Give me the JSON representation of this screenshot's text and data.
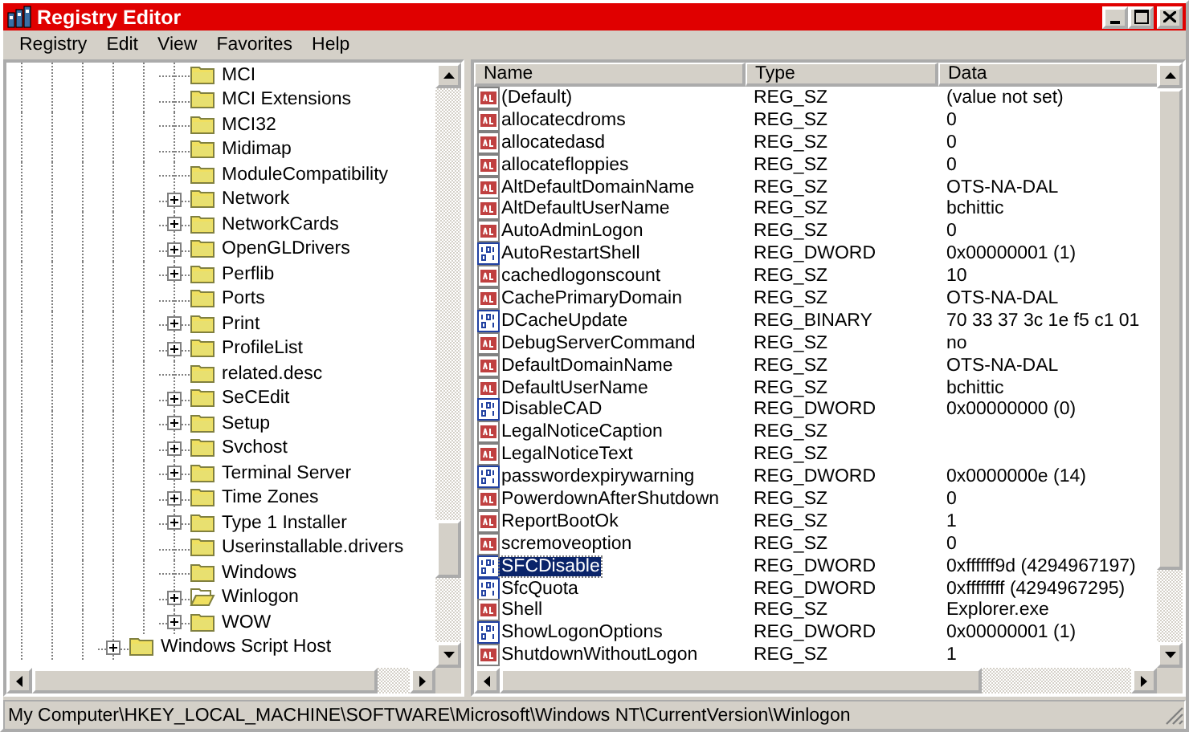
{
  "window": {
    "title": "Registry Editor"
  },
  "menu": [
    "Registry",
    "Edit",
    "View",
    "Favorites",
    "Help"
  ],
  "tree": {
    "nodes": [
      {
        "children": [
          {
            "children": [
              {
                "children": [
                  {
                    "children": [
                      {
                        "children": [
                          {
                            "label": "MCI",
                            "expandable": false,
                            "selected": false
                          },
                          {
                            "label": "MCI Extensions",
                            "expandable": false,
                            "selected": false
                          },
                          {
                            "label": "MCI32",
                            "expandable": false,
                            "selected": false
                          },
                          {
                            "label": "Midimap",
                            "expandable": false,
                            "selected": false
                          },
                          {
                            "label": "ModuleCompatibility",
                            "expandable": false,
                            "selected": false
                          },
                          {
                            "label": "Network",
                            "expandable": true,
                            "selected": false
                          },
                          {
                            "label": "NetworkCards",
                            "expandable": true,
                            "selected": false
                          },
                          {
                            "label": "OpenGLDrivers",
                            "expandable": true,
                            "selected": false
                          },
                          {
                            "label": "Perflib",
                            "expandable": true,
                            "selected": false
                          },
                          {
                            "label": "Ports",
                            "expandable": false,
                            "selected": false
                          },
                          {
                            "label": "Print",
                            "expandable": true,
                            "selected": false
                          },
                          {
                            "label": "ProfileList",
                            "expandable": true,
                            "selected": false
                          },
                          {
                            "label": "related.desc",
                            "expandable": false,
                            "selected": false
                          },
                          {
                            "label": "SeCEdit",
                            "expandable": true,
                            "selected": false
                          },
                          {
                            "label": "Setup",
                            "expandable": true,
                            "selected": false
                          },
                          {
                            "label": "Svchost",
                            "expandable": true,
                            "selected": false
                          },
                          {
                            "label": "Terminal Server",
                            "expandable": true,
                            "selected": false
                          },
                          {
                            "label": "Time Zones",
                            "expandable": true,
                            "selected": false
                          },
                          {
                            "label": "Type 1 Installer",
                            "expandable": true,
                            "selected": false
                          },
                          {
                            "label": "Userinstallable.drivers",
                            "expandable": false,
                            "selected": false
                          },
                          {
                            "label": "Windows",
                            "expandable": false,
                            "selected": false
                          },
                          {
                            "label": "Winlogon",
                            "expandable": true,
                            "selected": true
                          },
                          {
                            "label": "WOW",
                            "expandable": true,
                            "selected": false
                          }
                        ]
                      }
                    ]
                  },
                  {
                    "label": "Windows Script Host",
                    "expandable": true,
                    "selected": false
                  }
                ]
              }
            ]
          }
        ]
      }
    ]
  },
  "table": {
    "columns": [
      "Name",
      "Type",
      "Data"
    ],
    "rows": [
      {
        "kind": "string",
        "name": "(Default)",
        "type": "REG_SZ",
        "data": "(value not set)",
        "selected": false
      },
      {
        "kind": "string",
        "name": "allocatecdroms",
        "type": "REG_SZ",
        "data": "0",
        "selected": false
      },
      {
        "kind": "string",
        "name": "allocatedasd",
        "type": "REG_SZ",
        "data": "0",
        "selected": false
      },
      {
        "kind": "string",
        "name": "allocatefloppies",
        "type": "REG_SZ",
        "data": "0",
        "selected": false
      },
      {
        "kind": "string",
        "name": "AltDefaultDomainName",
        "type": "REG_SZ",
        "data": "OTS-NA-DAL",
        "selected": false
      },
      {
        "kind": "string",
        "name": "AltDefaultUserName",
        "type": "REG_SZ",
        "data": "bchittic",
        "selected": false
      },
      {
        "kind": "string",
        "name": "AutoAdminLogon",
        "type": "REG_SZ",
        "data": "0",
        "selected": false
      },
      {
        "kind": "binary",
        "name": "AutoRestartShell",
        "type": "REG_DWORD",
        "data": "0x00000001 (1)",
        "selected": false
      },
      {
        "kind": "string",
        "name": "cachedlogonscount",
        "type": "REG_SZ",
        "data": "10",
        "selected": false
      },
      {
        "kind": "string",
        "name": "CachePrimaryDomain",
        "type": "REG_SZ",
        "data": "OTS-NA-DAL",
        "selected": false
      },
      {
        "kind": "binary",
        "name": "DCacheUpdate",
        "type": "REG_BINARY",
        "data": "70 33 37 3c 1e f5 c1 01",
        "selected": false
      },
      {
        "kind": "string",
        "name": "DebugServerCommand",
        "type": "REG_SZ",
        "data": "no",
        "selected": false
      },
      {
        "kind": "string",
        "name": "DefaultDomainName",
        "type": "REG_SZ",
        "data": "OTS-NA-DAL",
        "selected": false
      },
      {
        "kind": "string",
        "name": "DefaultUserName",
        "type": "REG_SZ",
        "data": "bchittic",
        "selected": false
      },
      {
        "kind": "binary",
        "name": "DisableCAD",
        "type": "REG_DWORD",
        "data": "0x00000000 (0)",
        "selected": false
      },
      {
        "kind": "string",
        "name": "LegalNoticeCaption",
        "type": "REG_SZ",
        "selected": false
      },
      {
        "kind": "string",
        "name": "LegalNoticeText",
        "type": "REG_SZ",
        "selected": false
      },
      {
        "kind": "binary",
        "name": "passwordexpirywarning",
        "type": "REG_DWORD",
        "data": "0x0000000e (14)",
        "selected": false
      },
      {
        "kind": "string",
        "name": "PowerdownAfterShutdown",
        "type": "REG_SZ",
        "data": "0",
        "selected": false
      },
      {
        "kind": "string",
        "name": "ReportBootOk",
        "type": "REG_SZ",
        "data": "1",
        "selected": false
      },
      {
        "kind": "string",
        "name": "scremoveoption",
        "type": "REG_SZ",
        "data": "0",
        "selected": false
      },
      {
        "kind": "binary",
        "name": "SFCDisable",
        "type": "REG_DWORD",
        "data": "0xffffff9d (4294967197)",
        "selected": true
      },
      {
        "kind": "binary",
        "name": "SfcQuota",
        "type": "REG_DWORD",
        "data": "0xffffffff (4294967295)",
        "selected": false
      },
      {
        "kind": "string",
        "name": "Shell",
        "type": "REG_SZ",
        "data": "Explorer.exe",
        "selected": false
      },
      {
        "kind": "binary",
        "name": "ShowLogonOptions",
        "type": "REG_DWORD",
        "data": "0x00000001 (1)",
        "selected": false
      },
      {
        "kind": "string",
        "name": "ShutdownWithoutLogon",
        "type": "REG_SZ",
        "data": "1",
        "selected": false
      }
    ]
  },
  "status_bar": "My Computer\\HKEY_LOCAL_MACHINE\\SOFTWARE\\Microsoft\\Windows NT\\CurrentVersion\\Winlogon"
}
